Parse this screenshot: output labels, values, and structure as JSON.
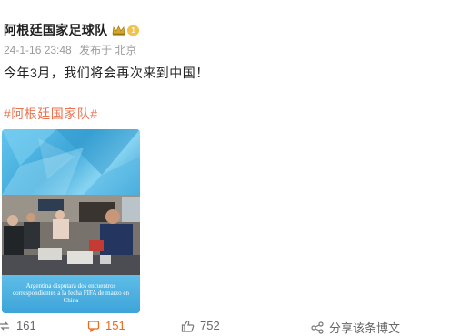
{
  "post": {
    "author": "阿根廷国家足球队",
    "badge_level": "1",
    "timestamp": "24-1-16 23:48",
    "source": "发布于 北京",
    "text": "今年3月，我们将会再次来到中国！",
    "hashtag": "#阿根廷国家队#",
    "media_caption": "Argentina disputará dos encuentros correspondientes a la fecha FIFA de marzo en China"
  },
  "actions": {
    "repost": "161",
    "comment": "151",
    "like": "752",
    "share": "分享该条博文"
  },
  "colors": {
    "hashtag": "#eb7350",
    "comment_active": "#ea6a1a",
    "meta": "#9a9a9a",
    "media_blue": "#4fb6e3"
  },
  "icons": [
    "crown-icon",
    "repost-icon",
    "comment-icon",
    "like-icon",
    "share-icon"
  ]
}
